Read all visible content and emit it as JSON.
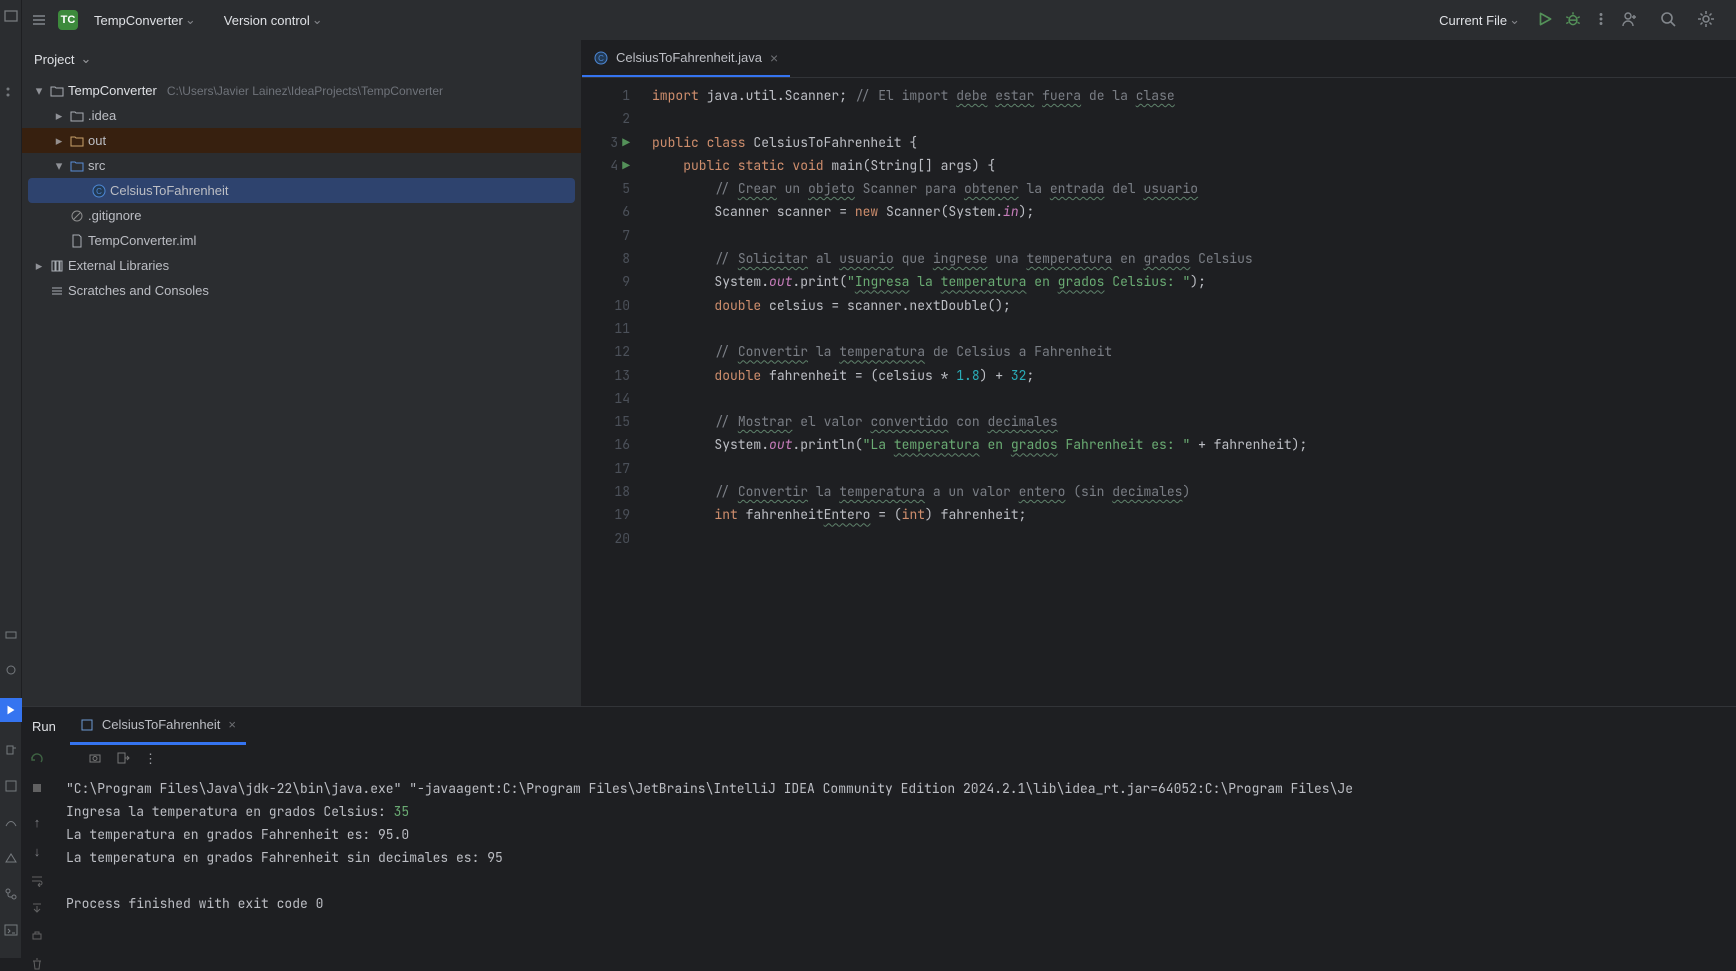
{
  "titlebar": {
    "project_badge": "TC",
    "project_name": "TempConverter",
    "vcs_label": "Version control",
    "run_config": "Current File"
  },
  "project_panel": {
    "title": "Project",
    "root_name": "TempConverter",
    "root_path": "C:\\Users\\Javier Lainez\\IdeaProjects\\TempConverter",
    "items": {
      "idea": ".idea",
      "out": "out",
      "src": "src",
      "file_class": "CelsiusToFahrenheit",
      "gitignore": ".gitignore",
      "iml": "TempConverter.iml"
    },
    "external_libs": "External Libraries",
    "scratches": "Scratches and Consoles"
  },
  "editor": {
    "tab_name": "CelsiusToFahrenheit.java",
    "lines": [
      "import java.util.Scanner; // El import debe estar fuera de la clase",
      "",
      "public class CelsiusToFahrenheit {",
      "    public static void main(String[] args) {",
      "        // Crear un objeto Scanner para obtener la entrada del usuario",
      "        Scanner scanner = new Scanner(System.in);",
      "",
      "        // Solicitar al usuario que ingrese una temperatura en grados Celsius",
      "        System.out.print(\"Ingresa la temperatura en grados Celsius: \");",
      "        double celsius = scanner.nextDouble();",
      "",
      "        // Convertir la temperatura de Celsius a Fahrenheit",
      "        double fahrenheit = (celsius * 1.8) + 32;",
      "",
      "        // Mostrar el valor convertido con decimales",
      "        System.out.println(\"La temperatura en grados Fahrenheit es: \" + fahrenheit);",
      "",
      "        // Convertir la temperatura a un valor entero (sin decimales)",
      "        int fahrenheitEntero = (int) fahrenheit;",
      ""
    ]
  },
  "run_panel": {
    "label": "Run",
    "tab_name": "CelsiusToFahrenheit",
    "cmd": "\"C:\\Program Files\\Java\\jdk-22\\bin\\java.exe\" \"-javaagent:C:\\Program Files\\JetBrains\\IntelliJ IDEA Community Edition 2024.2.1\\lib\\idea_rt.jar=64052:C:\\Program Files\\Je",
    "prompt_line_prefix": "Ingresa la temperatura en grados Celsius: ",
    "prompt_user_input": "35",
    "out1": "La temperatura en grados Fahrenheit es: 95.0",
    "out2": "La temperatura en grados Fahrenheit sin decimales es: 95",
    "exit": "Process finished with exit code 0"
  }
}
